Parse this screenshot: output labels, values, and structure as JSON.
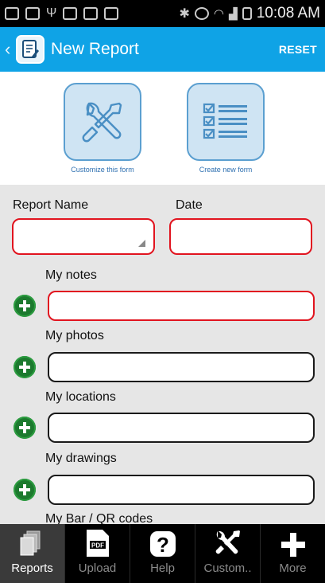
{
  "status_bar": {
    "time": "10:08 AM"
  },
  "action_bar": {
    "title": "New Report",
    "reset_label": "RESET"
  },
  "top_buttons": {
    "customize_label": "Customize this form",
    "create_label": "Create new form"
  },
  "form": {
    "report_name_label": "Report Name",
    "date_label": "Date",
    "sections": [
      {
        "label": "My notes"
      },
      {
        "label": "My photos"
      },
      {
        "label": "My locations"
      },
      {
        "label": "My drawings"
      },
      {
        "label": "My Bar / QR codes"
      }
    ]
  },
  "bottom_nav": {
    "items": [
      {
        "label": "Reports",
        "icon": "reports-icon"
      },
      {
        "label": "Upload",
        "icon": "pdf-icon"
      },
      {
        "label": "Help",
        "icon": "help-icon"
      },
      {
        "label": "Custom..",
        "icon": "tools-icon"
      },
      {
        "label": "More",
        "icon": "plus-icon"
      }
    ]
  },
  "colors": {
    "action_bar": "#0fa3e6",
    "required_border": "#e1141f",
    "add_button": "#1c7a2e"
  }
}
